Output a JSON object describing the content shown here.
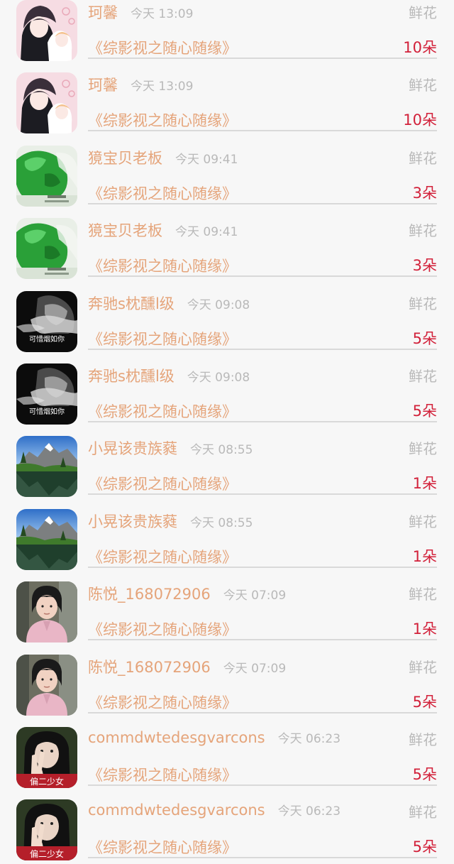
{
  "gift_rows": [
    {
      "username": "珂馨",
      "time": "今天 13:09",
      "gift_type": "鲜花",
      "book_title": "《综影视之随心随缘》",
      "gift_count": "10朵",
      "avatar": "anime-couple"
    },
    {
      "username": "珂馨",
      "time": "今天 13:09",
      "gift_type": "鲜花",
      "book_title": "《综影视之随心随缘》",
      "gift_count": "10朵",
      "avatar": "anime-couple"
    },
    {
      "username": "獍宝贝老板",
      "time": "今天 09:41",
      "gift_type": "鲜花",
      "book_title": "《综影视之随心随缘》",
      "gift_count": "3朵",
      "avatar": "green-jade"
    },
    {
      "username": "獍宝贝老板",
      "time": "今天 09:41",
      "gift_type": "鲜花",
      "book_title": "《综影视之随心随缘》",
      "gift_count": "3朵",
      "avatar": "green-jade"
    },
    {
      "username": "奔驰s枕醺l级",
      "time": "今天 09:08",
      "gift_type": "鲜花",
      "book_title": "《综影视之随心随缘》",
      "gift_count": "5朵",
      "avatar": "smoke-bw"
    },
    {
      "username": "奔驰s枕醺l级",
      "time": "今天 09:08",
      "gift_type": "鲜花",
      "book_title": "《综影视之随心随缘》",
      "gift_count": "5朵",
      "avatar": "smoke-bw"
    },
    {
      "username": "小晃该贵族蕤",
      "time": "今天 08:55",
      "gift_type": "鲜花",
      "book_title": "《综影视之随心随缘》",
      "gift_count": "1朵",
      "avatar": "mountain-lake"
    },
    {
      "username": "小晃该贵族蕤",
      "time": "今天 08:55",
      "gift_type": "鲜花",
      "book_title": "《综影视之随心随缘》",
      "gift_count": "1朵",
      "avatar": "mountain-lake"
    },
    {
      "username": "陈悦_168072906",
      "time": "今天 07:09",
      "gift_type": "鲜花",
      "book_title": "《综影视之随心随缘》",
      "gift_count": "1朵",
      "avatar": "girl-pink-coat"
    },
    {
      "username": "陈悦_168072906",
      "time": "今天 07:09",
      "gift_type": "鲜花",
      "book_title": "《综影视之随心随缘》",
      "gift_count": "5朵",
      "avatar": "girl-pink-coat"
    },
    {
      "username": "commdwtedesgvarcons",
      "time": "今天 06:23",
      "gift_type": "鲜花",
      "book_title": "《综影视之随心随缘》",
      "gift_count": "5朵",
      "avatar": "girl-peace-sign"
    },
    {
      "username": "commdwtedesgvarcons",
      "time": "今天 06:23",
      "gift_type": "鲜花",
      "book_title": "《综影视之随心随缘》",
      "gift_count": "5朵",
      "avatar": "girl-peace-sign"
    }
  ],
  "avatar_captions": {
    "smoke-bw": "可惜烟如你",
    "girl-peace-sign": "偏二少女"
  },
  "colors": {
    "name": "#e5a47a",
    "time": "#b9b9b9",
    "count": "#d2213a",
    "divider": "#d9d9d9",
    "background": "#f7f7f7"
  }
}
